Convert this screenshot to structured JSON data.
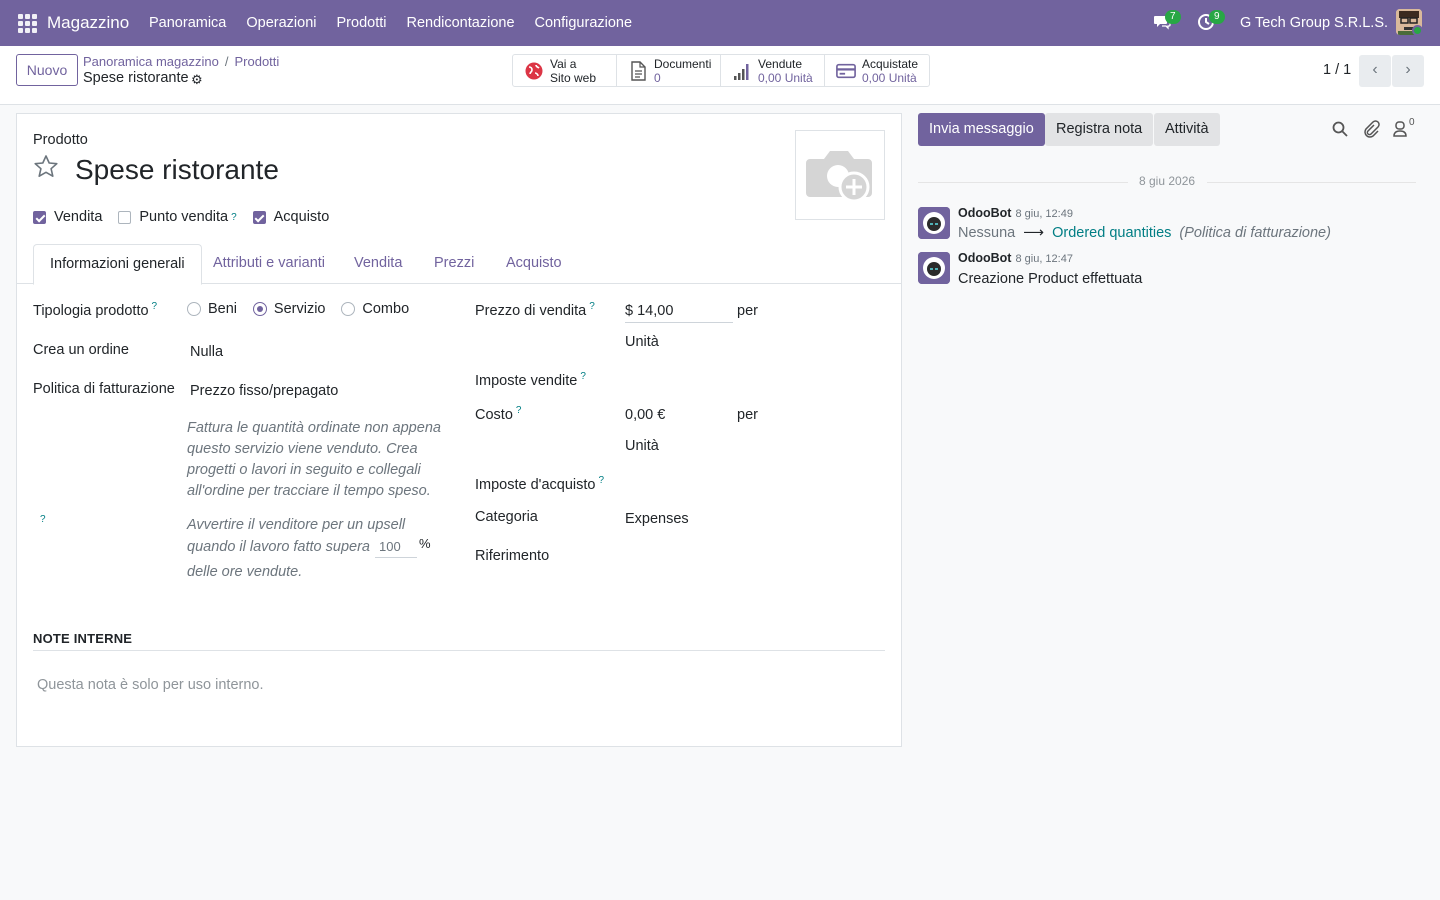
{
  "navbar": {
    "app_name": "Magazzino",
    "menu": [
      "Panoramica",
      "Operazioni",
      "Prodotti",
      "Rendicontazione",
      "Configurazione"
    ],
    "messages_count": "7",
    "activities_count": "9",
    "company": "G Tech Group S.R.L.S."
  },
  "control": {
    "new_button": "Nuovo",
    "breadcrumb": [
      "Panoramica magazzino",
      "Prodotti"
    ],
    "record_name": "Spese ristorante",
    "smart_buttons": [
      {
        "line1": "Vai a",
        "line2": "Sito web",
        "icon": "globe-icon"
      },
      {
        "line1": "Documenti",
        "line2": "0",
        "icon": "document-icon"
      },
      {
        "line1": "Vendute",
        "line2": "0,00 Unità",
        "icon": "bar-chart-icon"
      },
      {
        "line1": "Acquistate",
        "line2": "0,00 Unità",
        "icon": "credit-card-icon"
      }
    ],
    "pager": "1 / 1"
  },
  "form": {
    "product_label": "Prodotto",
    "title": "Spese ristorante",
    "checkboxes": [
      {
        "label": "Vendita",
        "checked": true
      },
      {
        "label": "Punto vendita",
        "checked": false,
        "help": "?"
      },
      {
        "label": "Acquisto",
        "checked": true
      }
    ],
    "tabs": [
      "Informazioni generali",
      "Attributi e varianti",
      "Vendita",
      "Prezzi",
      "Acquisto"
    ],
    "active_tab": "Informazioni generali",
    "left": {
      "type_label": "Tipologia prodotto",
      "type_options": [
        "Beni",
        "Servizio",
        "Combo"
      ],
      "type_selected": "Servizio",
      "create_order_label": "Crea un ordine",
      "create_order_value": "Nulla",
      "invoice_policy_label": "Politica di fatturazione",
      "invoice_policy_value": "Prezzo fisso/prepagato",
      "invoice_policy_help": "Fattura le quantità ordinate non appena questo servizio viene venduto. Crea progetti o lavori in seguito e collegali all'ordine per tracciare il tempo speso.",
      "upsell_text_1": "Avvertire il venditore per un upsell",
      "upsell_text_2": "quando il lavoro fatto supera",
      "upsell_value": "100",
      "upsell_percent": "%",
      "upsell_text_3": "delle ore vendute."
    },
    "right": {
      "sale_price_label": "Prezzo di vendita",
      "sale_price_value": "$ 14,00",
      "per": "per",
      "unit": "Unità",
      "sale_taxes_label": "Imposte vendite",
      "cost_label": "Costo",
      "cost_value": "0,00 €",
      "purchase_taxes_label": "Imposte d'acquisto",
      "category_label": "Categoria",
      "category_value": "Expenses",
      "reference_label": "Riferimento"
    },
    "notes_title": "NOTE INTERNE",
    "notes_placeholder": "Questa nota è solo per uso interno."
  },
  "chatter": {
    "send_message": "Invia messaggio",
    "log_note": "Registra nota",
    "activities": "Attività",
    "followers_count": "0",
    "date_separator": "8 giu 2026",
    "messages": [
      {
        "author": "OdooBot",
        "date": "8 giu, 12:49",
        "old": "Nessuna",
        "new": "Ordered quantities",
        "field": "(Politica di fatturazione)"
      },
      {
        "author": "OdooBot",
        "date": "8 giu, 12:47",
        "body": "Creazione Product effettuata"
      }
    ]
  },
  "colors": {
    "brand": "#71639e",
    "link": "#017e84",
    "badge": "#28a745"
  }
}
